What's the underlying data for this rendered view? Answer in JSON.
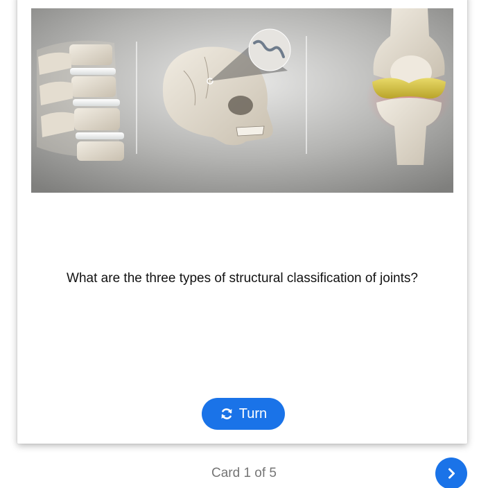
{
  "card": {
    "image": {
      "panels": [
        "spine-illustration",
        "skull-illustration",
        "knee-illustration"
      ]
    },
    "question": "What are the three types of structural classification of joints?",
    "turn_button": {
      "label": "Turn",
      "icon": "refresh-icon"
    }
  },
  "footer": {
    "counter": "Card 1 of 5",
    "next_icon": "chevron-right-icon"
  },
  "colors": {
    "accent": "#1a73e8",
    "counter_text": "#757575",
    "question_text": "#111111"
  }
}
